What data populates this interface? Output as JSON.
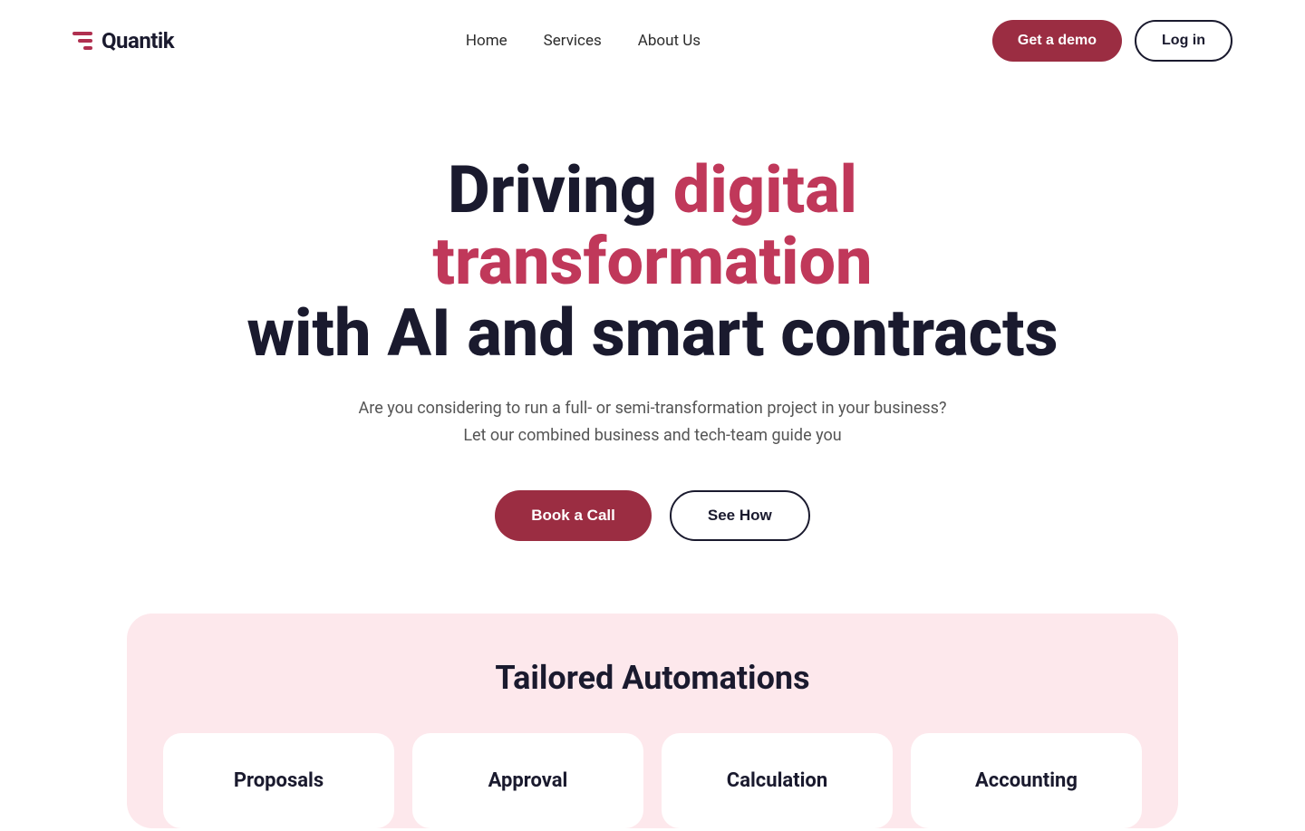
{
  "logo": {
    "text": "Quantik"
  },
  "nav": {
    "links": [
      {
        "label": "Home",
        "id": "home"
      },
      {
        "label": "Services",
        "id": "services"
      },
      {
        "label": "About Us",
        "id": "about"
      }
    ],
    "demo_label": "Get a demo",
    "login_label": "Log in"
  },
  "hero": {
    "title_plain": "Driving ",
    "title_highlight": "digital transformation",
    "title_rest": " with AI and smart contracts",
    "subtitle_line1": "Are you considering to run a full- or semi-transformation project in your business?",
    "subtitle_line2": "Let our combined business and tech-team guide you",
    "btn_book": "Book a Call",
    "btn_see": "See How"
  },
  "tailored": {
    "title": "Tailored Automations",
    "cards": [
      {
        "label": "Proposals"
      },
      {
        "label": "Approval"
      },
      {
        "label": "Calculation"
      },
      {
        "label": "Accounting"
      }
    ]
  },
  "colors": {
    "brand_red": "#9b2d42",
    "highlight_red": "#c0385a",
    "dark": "#1a1a2e",
    "light_pink_bg": "#fde8ec"
  }
}
